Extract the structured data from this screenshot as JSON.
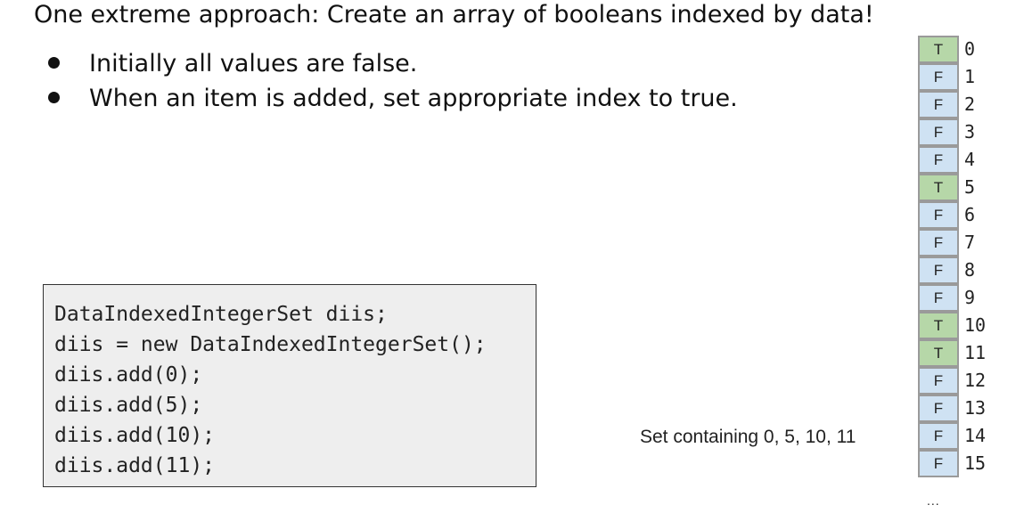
{
  "title": "One extreme approach: Create an array of booleans indexed by data!",
  "bullets": [
    "Initially all values are false.",
    "When an item is added, set appropriate index to true."
  ],
  "code": [
    "DataIndexedIntegerSet diis;",
    "diis = new DataIndexedIntegerSet();",
    "diis.add(0);",
    "diis.add(5);",
    "diis.add(10);",
    "diis.add(11);"
  ],
  "caption": "Set containing 0, 5, 10, 11",
  "array": [
    {
      "value": "T",
      "index": "0"
    },
    {
      "value": "F",
      "index": "1"
    },
    {
      "value": "F",
      "index": "2"
    },
    {
      "value": "F",
      "index": "3"
    },
    {
      "value": "F",
      "index": "4"
    },
    {
      "value": "T",
      "index": "5"
    },
    {
      "value": "F",
      "index": "6"
    },
    {
      "value": "F",
      "index": "7"
    },
    {
      "value": "F",
      "index": "8"
    },
    {
      "value": "F",
      "index": "9"
    },
    {
      "value": "T",
      "index": "10"
    },
    {
      "value": "T",
      "index": "11"
    },
    {
      "value": "F",
      "index": "12"
    },
    {
      "value": "F",
      "index": "13"
    },
    {
      "value": "F",
      "index": "14"
    },
    {
      "value": "F",
      "index": "15"
    }
  ],
  "ellipsis": "...",
  "colors": {
    "true_fill": "#b6d7a8",
    "false_fill": "#cfe2f3",
    "code_background": "#eeeeee"
  }
}
